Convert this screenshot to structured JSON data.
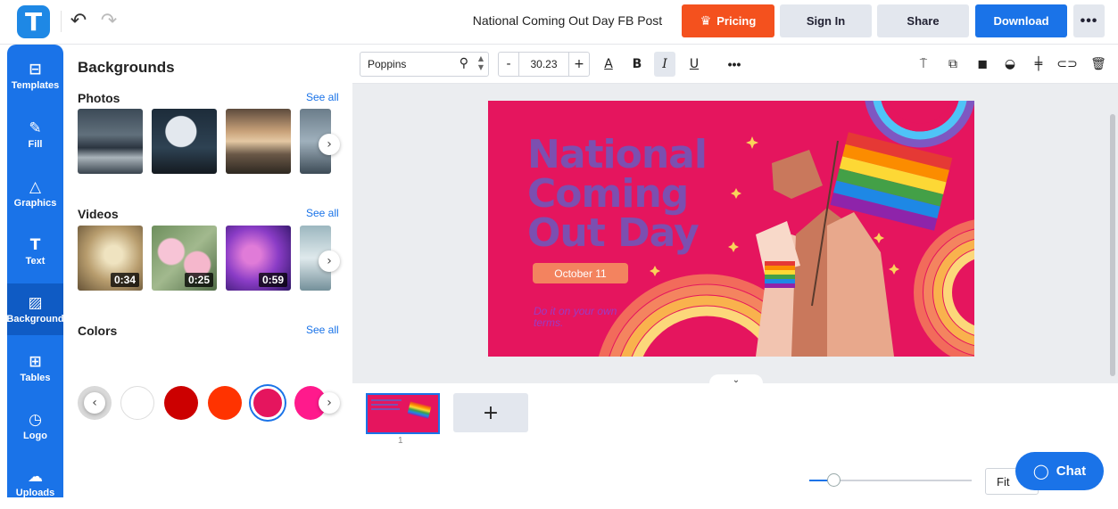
{
  "header": {
    "logo_letter": "T",
    "doc_title": "National Coming Out Day FB Post",
    "pricing_label": "Pricing",
    "signin_label": "Sign In",
    "share_label": "Share",
    "download_label": "Download",
    "more_label": "•••",
    "undo_icon": "undo-icon",
    "redo_icon": "redo-icon"
  },
  "sidebar": {
    "items": [
      {
        "label": "Templates",
        "icon": "templates-icon",
        "glyph": "⊞"
      },
      {
        "label": "Fill",
        "icon": "pencil-icon",
        "glyph": "✎"
      },
      {
        "label": "Graphics",
        "icon": "shapes-icon",
        "glyph": "△"
      },
      {
        "label": "Text",
        "icon": "text-icon",
        "glyph": "T"
      },
      {
        "label": "Background",
        "icon": "background-icon",
        "glyph": "▨"
      },
      {
        "label": "Tables",
        "icon": "table-icon",
        "glyph": "⊞"
      },
      {
        "label": "Logo",
        "icon": "logo-icon",
        "glyph": "◷"
      },
      {
        "label": "Uploads",
        "icon": "upload-icon",
        "glyph": "☁"
      }
    ],
    "active": "Background"
  },
  "panel": {
    "title": "Backgrounds",
    "photos": {
      "title": "Photos",
      "see_all": "See all"
    },
    "videos": {
      "title": "Videos",
      "see_all": "See all",
      "durations": [
        "0:34",
        "0:25",
        "0:59"
      ]
    },
    "colors": {
      "title": "Colors",
      "see_all": "See all",
      "swatches": [
        "#ffffff",
        "#cc0000",
        "#ff3300",
        "#e5155e",
        "#ff1a8c"
      ]
    }
  },
  "toolbar": {
    "font_name": "Poppins",
    "font_size": "30.23",
    "minus": "-",
    "plus": "+",
    "more": "•••"
  },
  "canvas": {
    "background": "#e5155e",
    "title_lines": [
      "National",
      "Coming",
      "Out Day"
    ],
    "date": "October 11",
    "tagline": "Do it on your own terms."
  },
  "pages": {
    "current": "1",
    "add_label": "+"
  },
  "zoom": {
    "fit_label": "Fit"
  },
  "chat": {
    "label": "Chat"
  }
}
